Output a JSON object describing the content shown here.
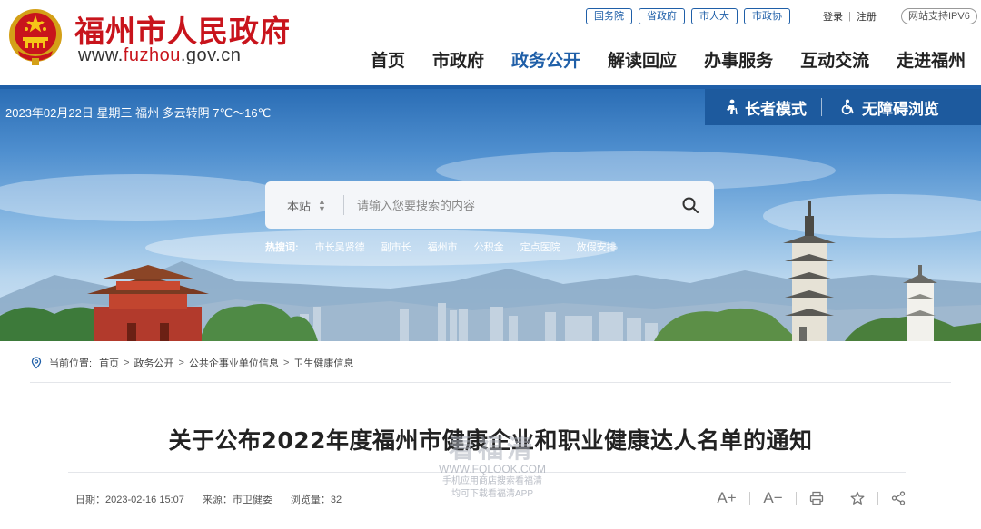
{
  "header": {
    "site_name": "福州市人民政府",
    "domain_prefix": "www.",
    "domain_accent": "fuzhou",
    "domain_suffix": ".gov.cn",
    "top_links": [
      "国务院",
      "省政府",
      "市人大",
      "市政协"
    ],
    "login": "登录",
    "auth_separator": "|",
    "register": "注册",
    "ipv6": "网站支持IPV6",
    "nav": [
      "首页",
      "市政府",
      "政务公开",
      "解读回应",
      "办事服务",
      "互动交流",
      "走进福州"
    ],
    "active_nav": "政务公开"
  },
  "banner": {
    "weather": "2023年02月22日 星期三 福州 多云转阴 7℃～16℃",
    "elder_mode": "长者模式",
    "accessible_mode": "无障碍浏览",
    "search": {
      "scope": "本站",
      "placeholder": "请输入您要搜索的内容"
    },
    "hot_label": "热搜词:",
    "hot_words": [
      "市长吴贤德",
      "副市长",
      "福州市",
      "公积金",
      "定点医院",
      "放假安排"
    ]
  },
  "breadcrumb": {
    "label": "当前位置:",
    "items": [
      "首页",
      "政务公开",
      "公共企事业单位信息",
      "卫生健康信息"
    ]
  },
  "article": {
    "title": "关于公布2022年度福州市健康企业和职业健康达人名单的通知",
    "date": "日期：2023-02-16 15:07",
    "source": "来源：市卫健委",
    "views": "浏览量：32",
    "font_increase": "A+",
    "font_decrease": "A−"
  },
  "watermark": {
    "main": "看福清",
    "url": "WWW.FQLOOK.COM",
    "line1": "手机应用商店搜索看福清",
    "line2": "均可下载看福清APP"
  },
  "colors": {
    "brand_red": "#c8141c",
    "brand_blue": "#1f5fa8",
    "mode_bar": "#1d5a9e"
  }
}
